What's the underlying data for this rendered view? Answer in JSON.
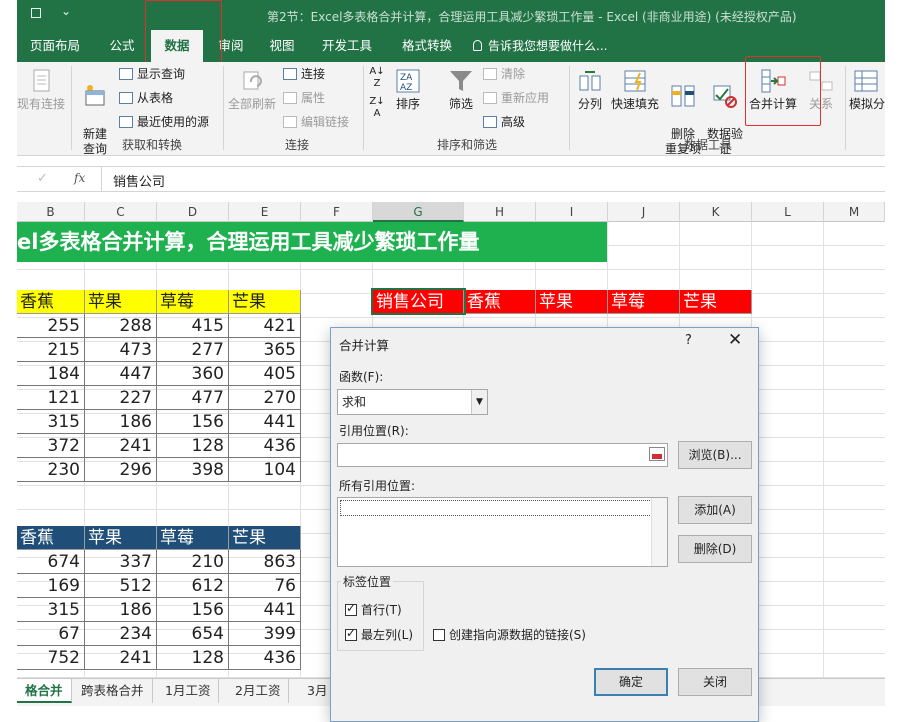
{
  "window": {
    "title": "第2节：Excel多表格合并计算，合理运用工具减少繁琐工作量 - Excel (非商业用途) (未经授权产品)"
  },
  "tabs": [
    "页面布局",
    "公式",
    "数据",
    "审阅",
    "视图",
    "开发工具",
    "格式转换"
  ],
  "active_tab": "数据",
  "tell_me": "告诉我您想要做什么...",
  "ribbon": {
    "existing_conn": "现有连接",
    "new_query": "新建\n查询",
    "show_query": "显示查询",
    "from_table": "从表格",
    "recent_sources": "最近使用的源",
    "group_get_transform": "获取和转换",
    "refresh_all": "全部刷新",
    "connections": "连接",
    "properties": "属性",
    "edit_links": "编辑链接",
    "group_connections": "连接",
    "sort": "排序",
    "filter": "筛选",
    "clear": "清除",
    "reapply": "重新应用",
    "advanced": "高级",
    "group_sort_filter": "排序和筛选",
    "text_to_columns": "分列",
    "flash_fill": "快速填充",
    "remove_dup": "删除\n重复项",
    "data_validation": "数据验\n证",
    "consolidate": "合并计算",
    "relationships": "关系",
    "group_data_tools": "数据工具",
    "what_if": "模拟分"
  },
  "formula_bar": {
    "cancel": "✓",
    "fx": "fx",
    "value": "销售公司"
  },
  "columns": [
    "B",
    "C",
    "D",
    "E",
    "F",
    "G",
    "H",
    "I",
    "J",
    "K",
    "L",
    "M"
  ],
  "sheet": {
    "banner": "el多表格合并计算，合理运用工具减少繁琐工作量",
    "table1": {
      "headers": [
        "香蕉",
        "苹果",
        "草莓",
        "芒果"
      ],
      "rows": [
        [
          "255",
          "288",
          "415",
          "421"
        ],
        [
          "215",
          "473",
          "277",
          "365"
        ],
        [
          "184",
          "447",
          "360",
          "405"
        ],
        [
          "121",
          "227",
          "477",
          "270"
        ],
        [
          "315",
          "186",
          "156",
          "441"
        ],
        [
          "372",
          "241",
          "128",
          "436"
        ],
        [
          "230",
          "296",
          "398",
          "104"
        ]
      ]
    },
    "table2": {
      "headers": [
        "香蕉",
        "苹果",
        "草莓",
        "芒果"
      ],
      "rows": [
        [
          "674",
          "337",
          "210",
          "863"
        ],
        [
          "169",
          "512",
          "612",
          "76"
        ],
        [
          "315",
          "186",
          "156",
          "441"
        ],
        [
          "67",
          "234",
          "654",
          "399"
        ],
        [
          "752",
          "241",
          "128",
          "436"
        ]
      ]
    },
    "result_headers": [
      "销售公司",
      "香蕉",
      "苹果",
      "草莓",
      "芒果"
    ]
  },
  "sheet_tabs": [
    "格合并",
    "跨表格合并",
    "1月工资",
    "2月工资",
    "3月"
  ],
  "dialog": {
    "title": "合并计算",
    "help": "?",
    "close": "✕",
    "function_label": "函数(F):",
    "function_value": "求和",
    "ref_label": "引用位置(R):",
    "ref_value": "",
    "browse": "浏览(B)...",
    "all_refs_label": "所有引用位置:",
    "add": "添加(A)",
    "delete": "删除(D)",
    "label_pos": "标签位置",
    "first_row": "首行(T)",
    "first_row_checked": true,
    "left_col": "最左列(L)",
    "left_col_checked": true,
    "create_links": "创建指向源数据的链接(S)",
    "create_links_checked": false,
    "ok": "确定",
    "cancel": "关闭"
  }
}
